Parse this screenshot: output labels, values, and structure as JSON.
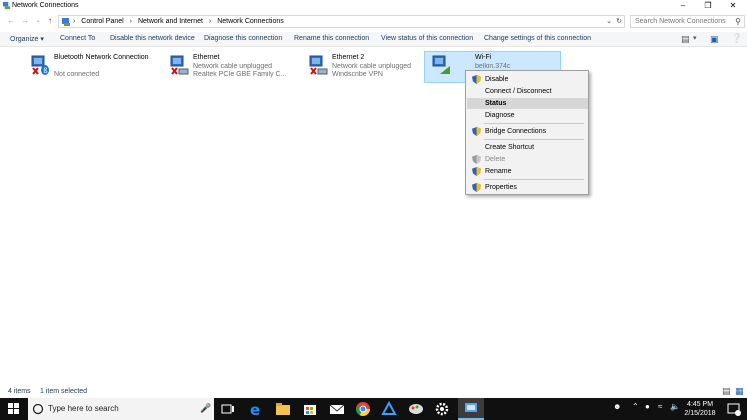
{
  "window": {
    "title": "Network Connections"
  },
  "address": {
    "crumbs": [
      "Control Panel",
      "Network and Internet",
      "Network Connections"
    ],
    "search_placeholder": "Search Network Connections"
  },
  "commands": [
    "Organize ▾",
    "Connect To",
    "Disable this network device",
    "Diagnose this connection",
    "Rename this connection",
    "View status of this connection",
    "Change settings of this connection"
  ],
  "items": [
    {
      "name": "Bluetooth Network Connection",
      "line2": "Not connected",
      "line3": ""
    },
    {
      "name": "Ethernet",
      "line2": "Network cable unplugged",
      "line3": "Realtek PCIe GBE Family C..."
    },
    {
      "name": "Ethernet 2",
      "line2": "Network cable unplugged",
      "line3": "Windscribe VPN"
    },
    {
      "name": "Wi-Fi",
      "line2": "belkin.374c",
      "line3": ""
    }
  ],
  "context_menu": {
    "disable": "Disable",
    "connect": "Connect / Disconnect",
    "status": "Status",
    "diagnose": "Diagnose",
    "bridge": "Bridge Connections",
    "shortcut": "Create Shortcut",
    "delete": "Delete",
    "rename": "Rename",
    "properties": "Properties"
  },
  "statusbar": {
    "count": "4 items",
    "selected": "1 item selected"
  },
  "taskbar": {
    "search_placeholder": "Type here to search",
    "time": "4:45 PM",
    "date": "2/15/2018"
  },
  "colors": {
    "accent": "#0078d7",
    "selection": "#cce8ff",
    "taskbar": "#101010"
  }
}
